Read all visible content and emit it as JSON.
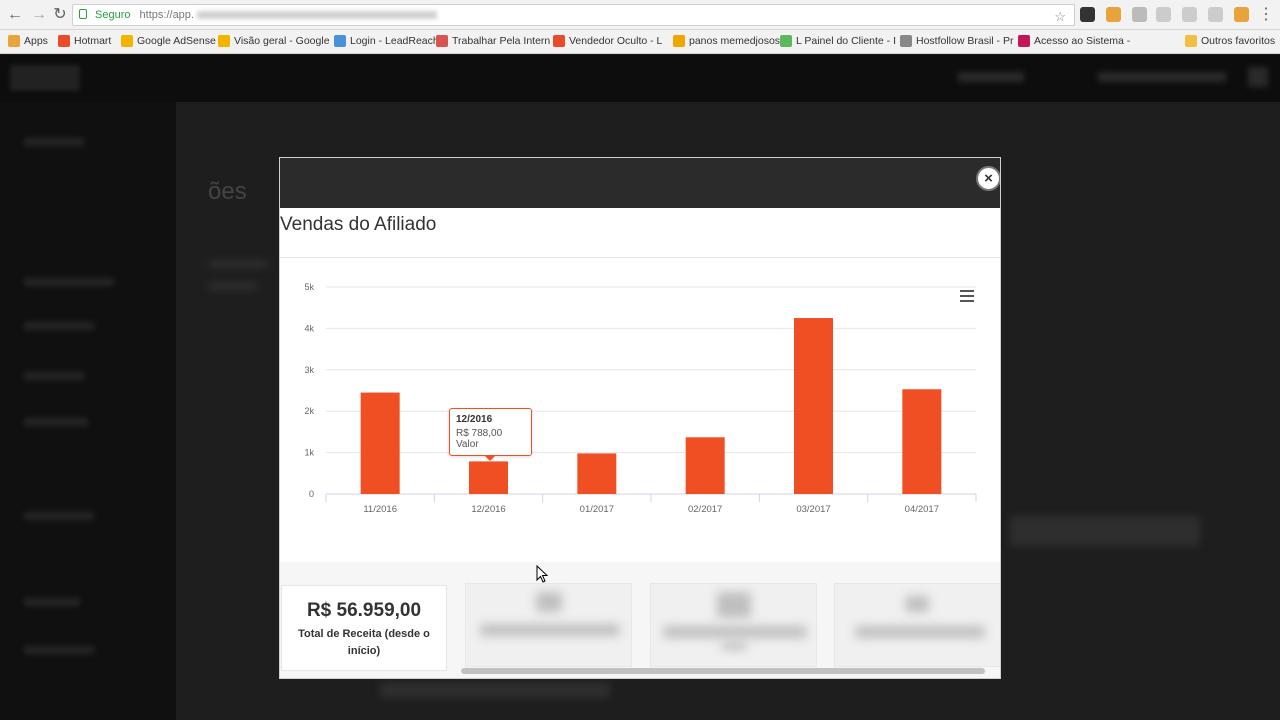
{
  "browser": {
    "address_secure_label": "Seguro",
    "address_url": "https://app.",
    "bookmarks": [
      {
        "label": "Apps",
        "color": "#e8a33b"
      },
      {
        "label": "Hotmart",
        "color": "#e94b2b"
      },
      {
        "label": "Google AdSense",
        "color": "#f4b400"
      },
      {
        "label": "Visão geral - Google",
        "color": "#f4b400"
      },
      {
        "label": "Login - LeadReach",
        "color": "#4a90d9"
      },
      {
        "label": "Trabalhar Pela Intern",
        "color": "#d9534f"
      },
      {
        "label": "Vendedor Oculto - L",
        "color": "#e94b2b"
      },
      {
        "label": "panos memedjosos",
        "color": "#f0a500"
      },
      {
        "label": "L Painel do Cliente - I",
        "color": "#5cb85c"
      },
      {
        "label": "Hostfollow Brasil - Pr",
        "color": "#888888"
      },
      {
        "label": "Acesso ao Sistema -",
        "color": "#c2185b"
      },
      {
        "label": "Outros favoritos",
        "color": "#f0c040"
      }
    ]
  },
  "background_page": {
    "title": "ões"
  },
  "modal": {
    "title": "Vendas do Afiliado",
    "close_label": "×"
  },
  "chart_data": {
    "type": "bar",
    "categories": [
      "11/2016",
      "12/2016",
      "01/2017",
      "02/2017",
      "03/2017",
      "04/2017"
    ],
    "values": [
      2450,
      788,
      980,
      1370,
      4250,
      2530
    ],
    "ylim": [
      0,
      5000
    ],
    "yticks": [
      0,
      1000,
      2000,
      3000,
      4000,
      5000
    ],
    "ytick_labels": [
      "0",
      "1k",
      "2k",
      "3k",
      "4k",
      "5k"
    ],
    "title": "",
    "xlabel": "",
    "ylabel": "",
    "color": "#f04e23",
    "grid": true
  },
  "tooltip": {
    "title": "12/2016",
    "body": "R$ 788,00 Valor"
  },
  "summary": {
    "total_value": "R$ 56.959,00",
    "total_label": "Total de Receita (desde o início)"
  }
}
